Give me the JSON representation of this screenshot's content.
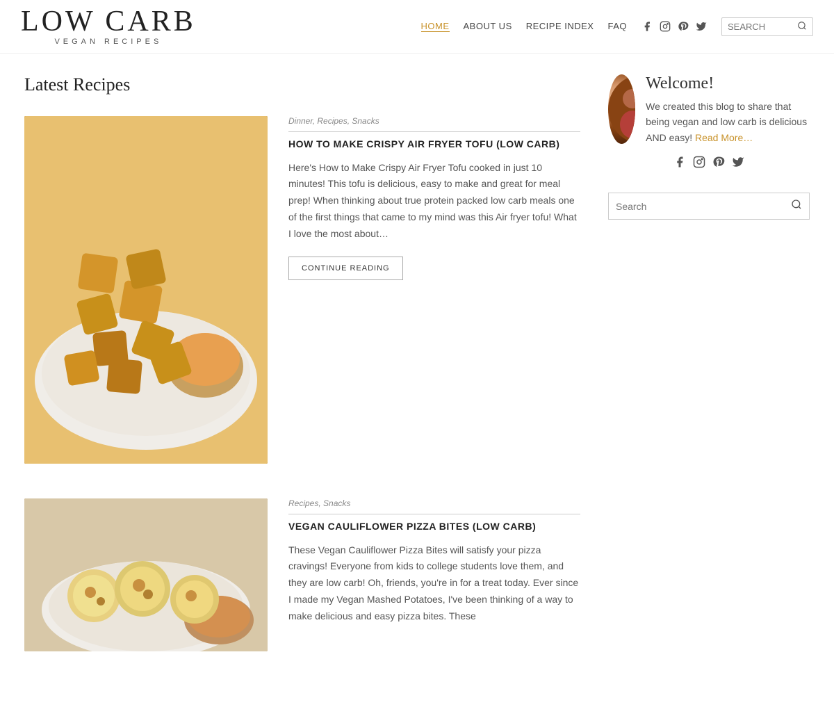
{
  "header": {
    "logo_top": "LOW CARB",
    "logo_bottom": "VEGAN RECIPES",
    "nav": [
      {
        "label": "HOME",
        "active": true
      },
      {
        "label": "ABOUT US",
        "active": false
      },
      {
        "label": "RECIPE INDEX",
        "active": false
      },
      {
        "label": "FAQ",
        "active": false
      }
    ],
    "search_placeholder": "SEARCH",
    "social_icons": [
      "facebook",
      "instagram",
      "pinterest",
      "twitter"
    ]
  },
  "main": {
    "section_title": "Latest Recipes",
    "articles": [
      {
        "categories": "Dinner, Recipes, Snacks",
        "title": "HOW TO MAKE CRISPY AIR FRYER TOFU (LOW CARB)",
        "excerpt": "Here's How to Make Crispy Air Fryer Tofu cooked in just 10 minutes! This tofu is delicious, easy to make and great for meal prep! When thinking about true protein packed low carb meals one of the first things that came to my mind was this Air fryer tofu! What I love the most about…",
        "continue_label": "CONTINUE READING"
      },
      {
        "categories": "Recipes, Snacks",
        "title": "VEGAN CAULIFLOWER PIZZA BITES (LOW CARB)",
        "excerpt": "These Vegan Cauliflower Pizza Bites will satisfy your pizza cravings! Everyone from kids to college students love them, and they are low carb! Oh, friends, you're in for a treat today. Ever since I made my Vegan Mashed Potatoes, I've been thinking of a way to make delicious and easy pizza bites. These"
      }
    ]
  },
  "sidebar": {
    "welcome_title": "Welcome!",
    "welcome_desc": "We created this blog to share that being vegan and low carb is delicious AND easy!",
    "read_more_label": "Read More…",
    "social_icons": [
      "facebook",
      "instagram",
      "pinterest",
      "twitter"
    ],
    "search_placeholder": "Search"
  }
}
